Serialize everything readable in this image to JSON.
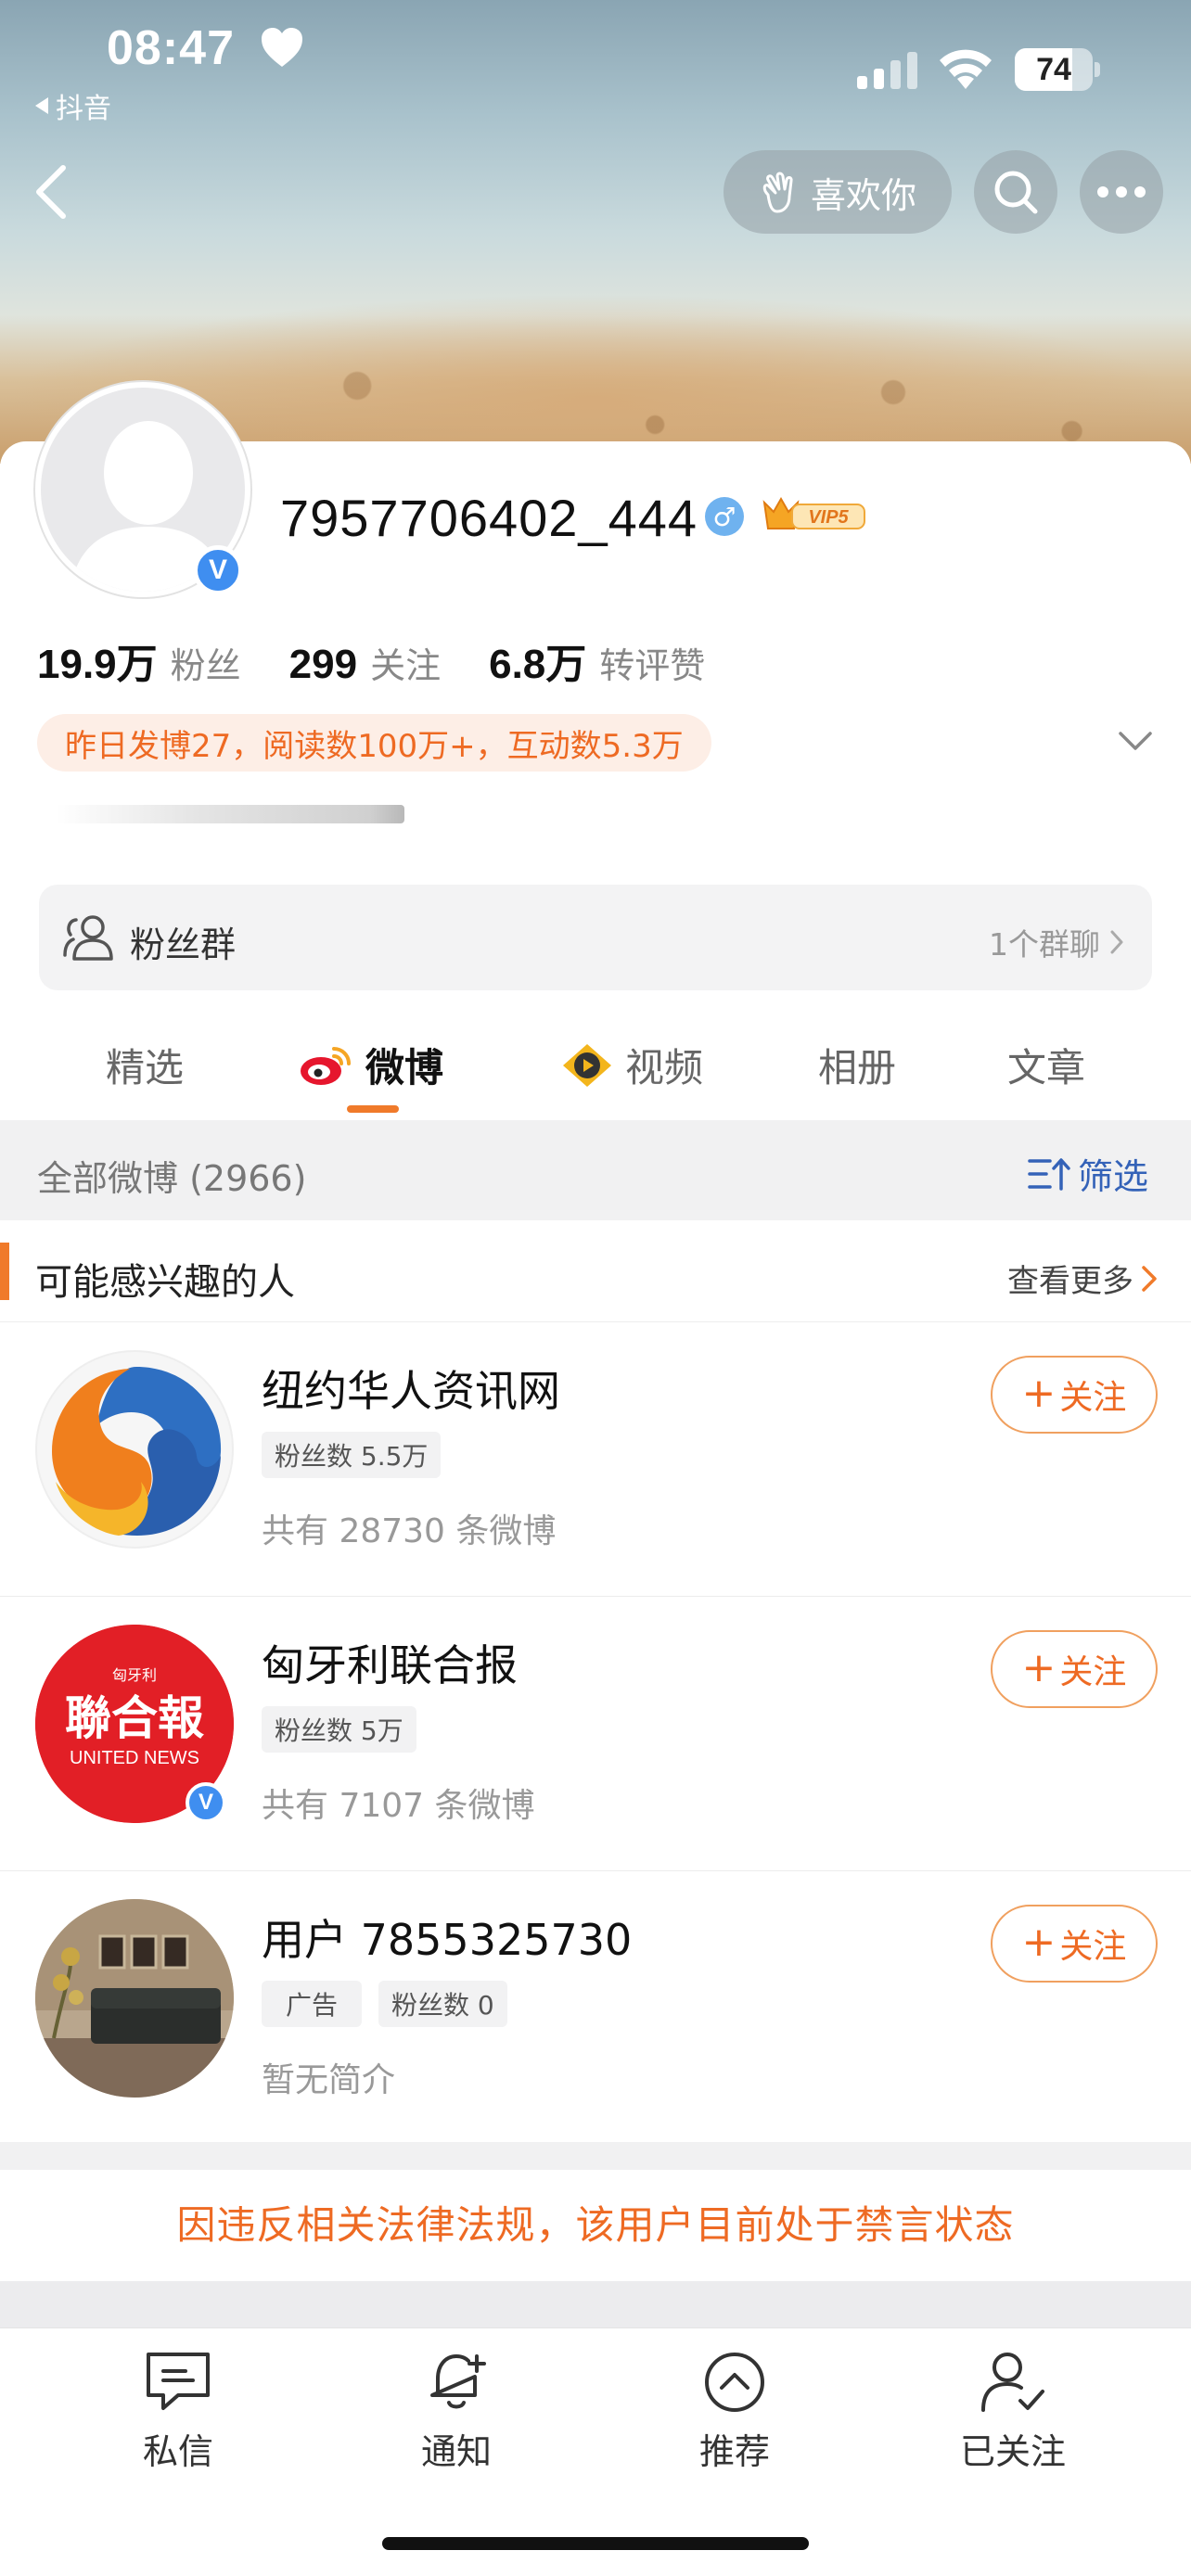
{
  "status_bar": {
    "time": "08:47",
    "back_app": "抖音",
    "battery": "74",
    "battery_level": 0.74
  },
  "header": {
    "like_label": "喜欢你"
  },
  "profile": {
    "username": "7957706402_444",
    "vip_label": "VIP5",
    "stats": [
      {
        "num": "19.9万",
        "label": "粉丝"
      },
      {
        "num": "299",
        "label": "关注"
      },
      {
        "num": "6.8万",
        "label": "转评赞"
      }
    ],
    "notice": "昨日发博27，阅读数100万+，互动数5.3万"
  },
  "fans_group": {
    "label": "粉丝群",
    "count": "1个群聊"
  },
  "tabs": [
    {
      "label": "精选",
      "active": false
    },
    {
      "label": "微博",
      "active": true
    },
    {
      "label": "视频",
      "active": false
    },
    {
      "label": "相册",
      "active": false
    },
    {
      "label": "文章",
      "active": false
    }
  ],
  "filter_bar": {
    "count_label": "全部微博 (2966)",
    "filter_label": "筛选"
  },
  "recommend": {
    "title": "可能感兴趣的人",
    "more": "查看更多",
    "follow_label": "关注",
    "items": [
      {
        "name": "纽约华人资讯网",
        "tags": [
          "粉丝数 5.5万"
        ],
        "desc": "共有 28730 条微博"
      },
      {
        "name": "匈牙利联合报",
        "tags": [
          "粉丝数 5万"
        ],
        "desc": "共有 7107 条微博",
        "logo_top": "匈牙利",
        "logo_main": "聯合報",
        "logo_sub": "UNITED NEWS"
      },
      {
        "name": "用户 7855325730",
        "tags": [
          "广告",
          "粉丝数 0"
        ],
        "desc": "暂无简介"
      }
    ]
  },
  "banned_notice": "因违反相关法律法规，该用户目前处于禁言状态",
  "bottom_bar": [
    {
      "label": "私信",
      "icon": "message-icon"
    },
    {
      "label": "通知",
      "icon": "bell-plus-icon"
    },
    {
      "label": "推荐",
      "icon": "chevron-up-circle-icon"
    },
    {
      "label": "已关注",
      "icon": "user-check-icon"
    }
  ],
  "colors": {
    "accent": "#ee6a23",
    "link": "#3462b8",
    "verify": "#3f8ef0"
  }
}
